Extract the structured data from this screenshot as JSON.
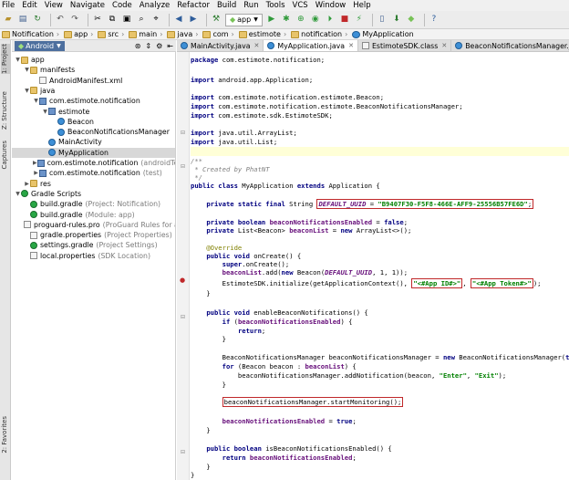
{
  "menu": [
    "File",
    "Edit",
    "View",
    "Navigate",
    "Code",
    "Analyze",
    "Refactor",
    "Build",
    "Run",
    "Tools",
    "VCS",
    "Window",
    "Help"
  ],
  "toolbar": {
    "run_config": "app"
  },
  "breadcrumb": [
    "Notification",
    "app",
    "src",
    "main",
    "java",
    "com",
    "estimote",
    "notification",
    "MyApplication"
  ],
  "side_tabs": {
    "project": "1: Project",
    "structure": "Z: Structure",
    "captures": "Captures",
    "favorites": "2: Favorites"
  },
  "project": {
    "view": "Android",
    "tree": [
      {
        "label": "app",
        "extra": "",
        "level": 0,
        "expanded": true,
        "icon": "folder-icon"
      },
      {
        "label": "manifests",
        "extra": "",
        "level": 1,
        "expanded": true,
        "icon": "folder-icon"
      },
      {
        "label": "AndroidManifest.xml",
        "extra": "",
        "level": 2,
        "icon": "file-icon"
      },
      {
        "label": "java",
        "extra": "",
        "level": 1,
        "expanded": true,
        "icon": "folder-icon"
      },
      {
        "label": "com.estimote.notification",
        "extra": "",
        "level": 2,
        "expanded": true,
        "icon": "package-icon"
      },
      {
        "label": "estimote",
        "extra": "",
        "level": 3,
        "expanded": true,
        "icon": "package-icon"
      },
      {
        "label": "Beacon",
        "extra": "",
        "level": 4,
        "icon": "class-icon"
      },
      {
        "label": "BeaconNotificationsManager",
        "extra": "",
        "level": 4,
        "icon": "class-icon"
      },
      {
        "label": "MainActivity",
        "extra": "",
        "level": 3,
        "icon": "class-icon"
      },
      {
        "label": "MyApplication",
        "extra": "",
        "level": 3,
        "icon": "class-icon",
        "selected": true
      },
      {
        "label": "com.estimote.notification",
        "extra": "(androidTest)",
        "level": 2,
        "expanded": false,
        "icon": "package-icon"
      },
      {
        "label": "com.estimote.notification",
        "extra": "(test)",
        "level": 2,
        "expanded": false,
        "icon": "package-icon"
      },
      {
        "label": "res",
        "extra": "",
        "level": 1,
        "expanded": false,
        "icon": "folder-icon"
      },
      {
        "label": "Gradle Scripts",
        "extra": "",
        "level": 0,
        "expanded": true,
        "icon": "gradle-icon"
      },
      {
        "label": "build.gradle",
        "extra": "(Project: Notification)",
        "level": 1,
        "icon": "gradle-icon"
      },
      {
        "label": "build.gradle",
        "extra": "(Module: app)",
        "level": 1,
        "icon": "gradle-icon"
      },
      {
        "label": "proguard-rules.pro",
        "extra": "(ProGuard Rules for app)",
        "level": 1,
        "icon": "file-icon"
      },
      {
        "label": "gradle.properties",
        "extra": "(Project Properties)",
        "level": 1,
        "icon": "file-icon"
      },
      {
        "label": "settings.gradle",
        "extra": "(Project Settings)",
        "level": 1,
        "icon": "gradle-icon"
      },
      {
        "label": "local.properties",
        "extra": "(SDK Location)",
        "level": 1,
        "icon": "file-icon"
      }
    ]
  },
  "tabs": [
    {
      "label": "MainActivity.java",
      "active": false
    },
    {
      "label": "MyApplication.java",
      "active": true
    },
    {
      "label": "EstimoteSDK.class",
      "active": false
    },
    {
      "label": "BeaconNotificationsManager.java",
      "active": false
    },
    {
      "label": "BeaconMan",
      "active": false
    }
  ],
  "code": {
    "package": "com.estimote.notification;",
    "imports": [
      "android.app.Application;",
      "com.estimote.notification.estimote.Beacon;",
      "com.estimote.notification.estimote.BeaconNotificationsManager;",
      "com.estimote.sdk.EstimoteSDK;",
      "java.util.ArrayList;",
      "java.util.List;"
    ],
    "comment_open": "/**",
    "comment_author": " * Created by PhatNT",
    "comment_close": " */",
    "class_name": "MyApplication",
    "super_class": "Application",
    "uuid_field": "DEFAULT_UUID",
    "uuid_value": "\"B9407F30-F5F8-466E-AFF9-25556B57FE6D\"",
    "app_id": "\"<#App ID#>\"",
    "app_token": "\"<#App Token#>\"",
    "enter": "\"Enter\"",
    "exit": "\"Exit\""
  }
}
